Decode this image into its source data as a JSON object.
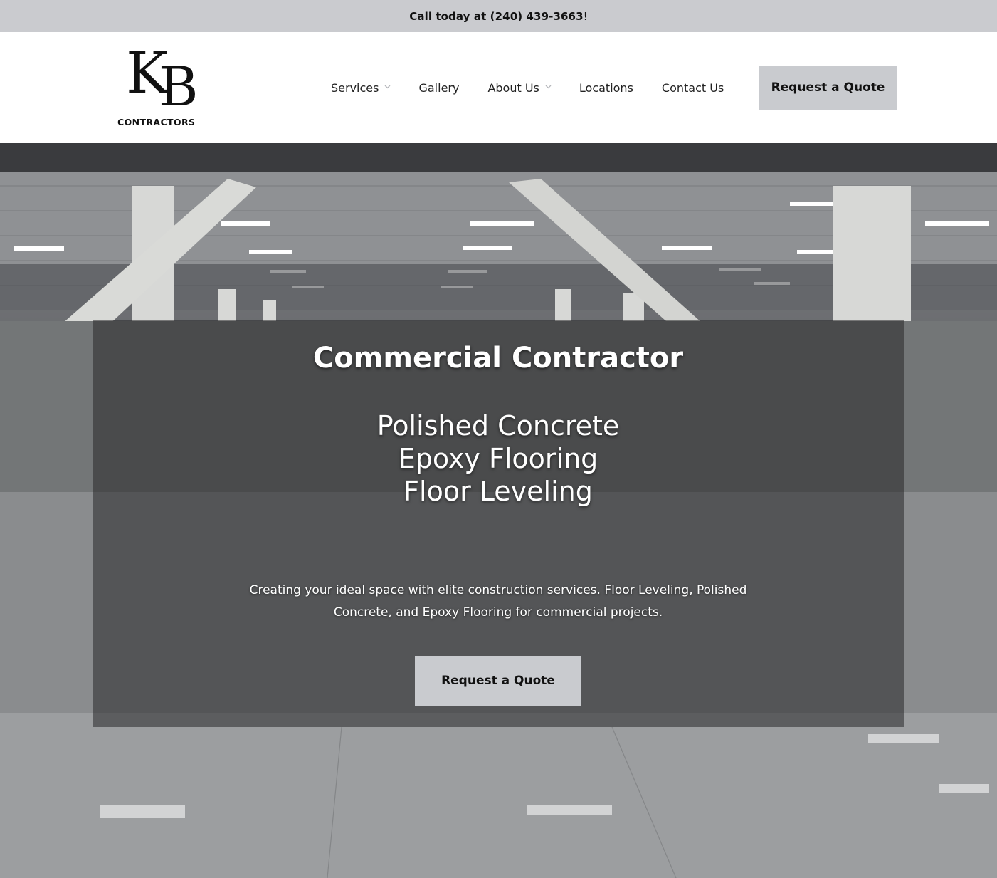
{
  "topbar": {
    "call_text": "Call today at (240) 439-3663",
    "call_suffix": "!"
  },
  "logo": {
    "monogram_k": "K",
    "monogram_b": "B",
    "wordmark": "CONTRACTORS"
  },
  "nav": {
    "items": [
      {
        "label": "Services",
        "has_dropdown": true
      },
      {
        "label": "Gallery",
        "has_dropdown": false
      },
      {
        "label": "About Us",
        "has_dropdown": true
      },
      {
        "label": "Locations",
        "has_dropdown": false
      },
      {
        "label": "Contact Us",
        "has_dropdown": false
      }
    ],
    "cta_label": "Request a Quote"
  },
  "hero": {
    "title": "Commercial Contractor",
    "services": [
      "Polished Concrete",
      "Epoxy Flooring",
      "Floor Leveling"
    ],
    "description": "Creating your ideal space with elite construction services. Floor Leveling, Polished Concrete, and Epoxy Flooring for commercial projects.",
    "cta_label": "Request a Quote"
  },
  "colors": {
    "topbar_bg": "#cacbcf",
    "button_bg": "#c9cbcf",
    "overlay": "rgba(40,40,42,0.55)",
    "text_dark": "#111111",
    "text_light": "#ffffff"
  }
}
